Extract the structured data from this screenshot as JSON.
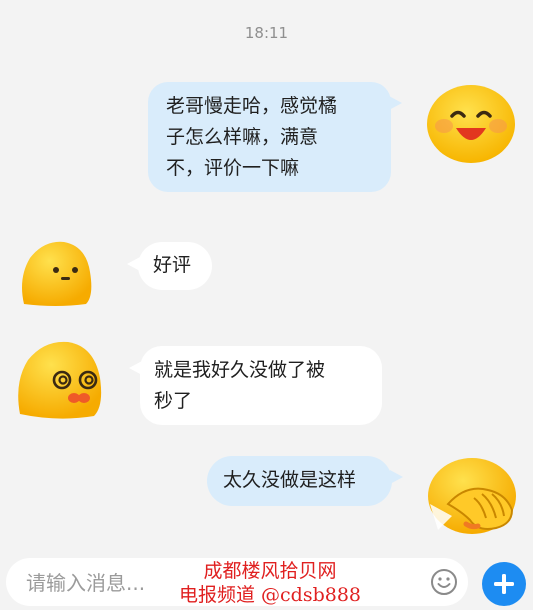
{
  "chat": {
    "timestamp": "18:11",
    "messages": [
      {
        "side": "out",
        "lines": [
          "老哥慢走哈，感觉橘",
          "子怎么样嘛，满意",
          "不，评价一下嘛"
        ],
        "avatar_icon": "laughing-blob-emoji-icon"
      },
      {
        "side": "in",
        "lines": [
          "好评"
        ],
        "avatar_icon": "neutral-blob-emoji-icon"
      },
      {
        "side": "in",
        "lines": [
          "就是我好久没做了被",
          "秒了"
        ],
        "avatar_icon": "dizzy-blob-emoji-icon"
      },
      {
        "side": "out",
        "lines": [
          "太久没做是这样"
        ],
        "avatar_icon": "facepalm-blob-emoji-icon"
      }
    ]
  },
  "input_bar": {
    "placeholder": "请输入消息...",
    "emoji_icon": "smiley-icon",
    "plus_icon": "plus-icon"
  },
  "watermark": {
    "line1": "成都楼风拾贝网",
    "line2": "电报频道 @cdsb888"
  },
  "colors": {
    "background": "#f3f3f3",
    "outgoing_bubble": "#d9ecfb",
    "incoming_bubble": "#ffffff",
    "accent": "#1d8cf2",
    "watermark": "#e02020",
    "emoji_yellow": "#ffc928"
  }
}
